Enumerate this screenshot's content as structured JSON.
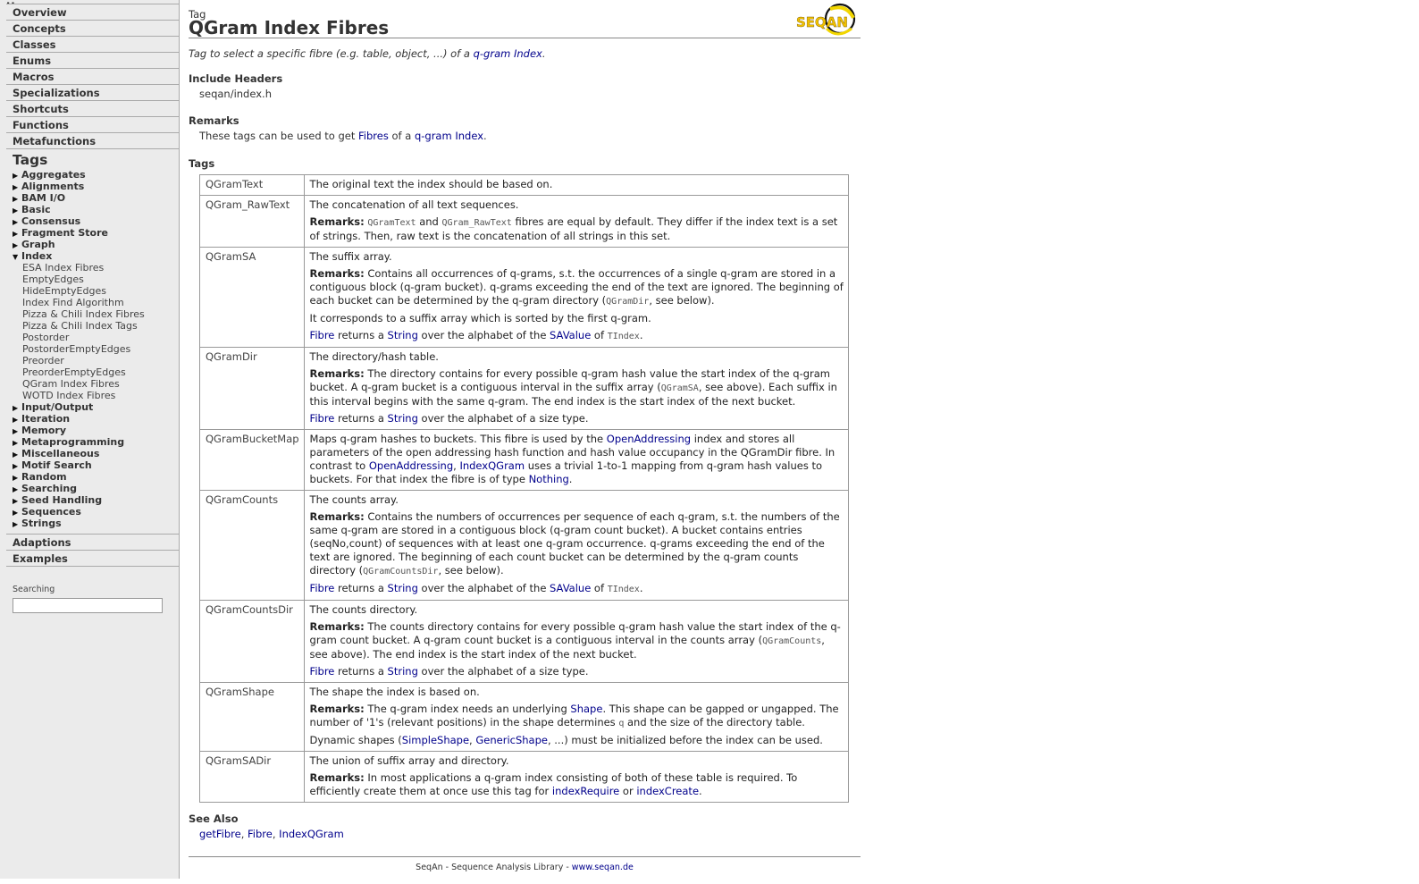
{
  "nav": {
    "top_cut": "Home",
    "cats_top": [
      "Overview",
      "Concepts",
      "Classes",
      "Enums",
      "Macros",
      "Specializations",
      "Shortcuts",
      "Functions",
      "Metafunctions"
    ],
    "tags_title": "Tags",
    "groups_a": [
      "Aggregates",
      "Alignments",
      "BAM I/O",
      "Basic",
      "Consensus",
      "Fragment Store",
      "Graph"
    ],
    "open_group": "Index",
    "index_items": [
      "ESA Index Fibres",
      "EmptyEdges",
      "HideEmptyEdges",
      "Index Find Algorithm",
      "Pizza & Chili Index Fibres",
      "Pizza & Chili Index Tags",
      "Postorder",
      "PostorderEmptyEdges",
      "Preorder",
      "PreorderEmptyEdges",
      "QGram Index Fibres",
      "WOTD Index Fibres"
    ],
    "groups_b": [
      "Input/Output",
      "Iteration",
      "Memory",
      "Metaprogramming",
      "Miscellaneous",
      "Motif Search",
      "Random",
      "Searching",
      "Seed Handling",
      "Sequences",
      "Strings"
    ],
    "cats_bottom": [
      "Adaptions",
      "Examples"
    ],
    "search_label": "Searching",
    "search_value": ""
  },
  "page": {
    "kind": "Tag",
    "title": "QGram Index Fibres",
    "logo_text": "SEQAN",
    "summary_prefix": "Tag to select a specific fibre (e.g. table, object, ...) of a ",
    "summary_link": "q-gram Index",
    "summary_suffix": ".",
    "include_heading": "Include Headers",
    "include_value": "seqan/index.h",
    "remarks_heading": "Remarks",
    "remarks_prefix": "These tags can be used to get ",
    "remarks_link1": "Fibres",
    "remarks_mid": " of a ",
    "remarks_link2": "q-gram Index",
    "remarks_suffix": ".",
    "tags_heading": "Tags",
    "see_also_heading": "See Also",
    "see_also": [
      "getFibre",
      "Fibre",
      "IndexQGram"
    ],
    "footer_text": "SeqAn - Sequence Analysis Library - ",
    "footer_link": "www.seqan.de"
  },
  "tags": [
    {
      "name": "QGramText",
      "paras": [
        [
          {
            "t": "The original text the index should be based on."
          }
        ]
      ]
    },
    {
      "name": "QGram_RawText",
      "paras": [
        [
          {
            "t": "The concatenation of all text sequences."
          }
        ],
        [
          {
            "b": "Remarks:"
          },
          {
            "t": " "
          },
          {
            "c": "QGramText"
          },
          {
            "t": " and "
          },
          {
            "c": "QGram_RawText"
          },
          {
            "t": " fibres are equal by default. They differ if the index text is a set of strings. Then, raw text is the concatenation of all strings in this set."
          }
        ]
      ]
    },
    {
      "name": "QGramSA",
      "paras": [
        [
          {
            "t": "The suffix array."
          }
        ],
        [
          {
            "b": "Remarks:"
          },
          {
            "t": " Contains all occurrences of q-grams, s.t. the occurrences of a single q-gram are stored in a contiguous block (q-gram bucket). q-grams exceeding the end of the text are ignored. The beginning of each bucket can be determined by the q-gram directory ("
          },
          {
            "c": "QGramDir"
          },
          {
            "t": ", see below)."
          }
        ],
        [
          {
            "t": "It corresponds to a suffix array which is sorted by the first q-gram."
          }
        ],
        [
          {
            "a": "Fibre"
          },
          {
            "t": " returns a "
          },
          {
            "a": "String"
          },
          {
            "t": " over the alphabet of the "
          },
          {
            "a": "SAValue"
          },
          {
            "t": " of "
          },
          {
            "c": "TIndex"
          },
          {
            "t": "."
          }
        ]
      ]
    },
    {
      "name": "QGramDir",
      "paras": [
        [
          {
            "t": "The directory/hash table."
          }
        ],
        [
          {
            "b": "Remarks:"
          },
          {
            "t": " The directory contains for every possible q-gram hash value the start index of the q-gram bucket. A q-gram bucket is a contiguous interval in the suffix array ("
          },
          {
            "c": "QGramSA"
          },
          {
            "t": ", see above). Each suffix in this interval begins with the same q-gram. The end index is the start index of the next bucket."
          }
        ],
        [
          {
            "a": "Fibre"
          },
          {
            "t": " returns a "
          },
          {
            "a": "String"
          },
          {
            "t": " over the alphabet of a size type."
          }
        ]
      ]
    },
    {
      "name": "QGramBucketMap",
      "paras": [
        [
          {
            "t": "Maps q-gram hashes to buckets. This fibre is used by the "
          },
          {
            "a": "OpenAddressing"
          },
          {
            "t": " index and stores all parameters of the open addressing hash function and hash value occupancy in the QGramDir fibre. In contrast to "
          },
          {
            "a": "OpenAddressing"
          },
          {
            "t": ", "
          },
          {
            "a": "IndexQGram"
          },
          {
            "t": " uses a trivial 1-to-1 mapping from q-gram hash values to buckets. For that index the fibre is of type "
          },
          {
            "a": "Nothing"
          },
          {
            "t": "."
          }
        ]
      ]
    },
    {
      "name": "QGramCounts",
      "paras": [
        [
          {
            "t": "The counts array."
          }
        ],
        [
          {
            "b": "Remarks:"
          },
          {
            "t": " Contains the numbers of occurrences per sequence of each q-gram, s.t. the numbers of the same q-gram are stored in a contiguous block (q-gram count bucket). A bucket contains entries (seqNo,count) of sequences with at least one q-gram occurrence. q-grams exceeding the end of the text are ignored. The beginning of each count bucket can be determined by the q-gram counts directory ("
          },
          {
            "c": "QGramCountsDir"
          },
          {
            "t": ", see below)."
          }
        ],
        [
          {
            "a": "Fibre"
          },
          {
            "t": " returns a "
          },
          {
            "a": "String"
          },
          {
            "t": " over the alphabet of the "
          },
          {
            "a": "SAValue"
          },
          {
            "t": " of "
          },
          {
            "c": "TIndex"
          },
          {
            "t": "."
          }
        ]
      ]
    },
    {
      "name": "QGramCountsDir",
      "paras": [
        [
          {
            "t": "The counts directory."
          }
        ],
        [
          {
            "b": "Remarks:"
          },
          {
            "t": " The counts directory contains for every possible q-gram hash value the start index of the q-gram count bucket. A q-gram count bucket is a contiguous interval in the counts array ("
          },
          {
            "c": "QGramCounts"
          },
          {
            "t": ", see above). The end index is the start index of the next bucket."
          }
        ],
        [
          {
            "a": "Fibre"
          },
          {
            "t": " returns a "
          },
          {
            "a": "String"
          },
          {
            "t": " over the alphabet of a size type."
          }
        ]
      ]
    },
    {
      "name": "QGramShape",
      "paras": [
        [
          {
            "t": "The shape the index is based on."
          }
        ],
        [
          {
            "b": "Remarks:"
          },
          {
            "t": " The q-gram index needs an underlying "
          },
          {
            "a": "Shape"
          },
          {
            "t": ". This shape can be gapped or ungapped. The number of '1's (relevant positions) in the shape determines "
          },
          {
            "c": "q"
          },
          {
            "t": " and the size of the directory table."
          }
        ],
        [
          {
            "t": "Dynamic shapes ("
          },
          {
            "a": "SimpleShape"
          },
          {
            "t": ", "
          },
          {
            "a": "GenericShape"
          },
          {
            "t": ", ...) must be initialized before the index can be used."
          }
        ]
      ]
    },
    {
      "name": "QGramSADir",
      "paras": [
        [
          {
            "t": "The union of suffix array and directory."
          }
        ],
        [
          {
            "b": "Remarks:"
          },
          {
            "t": " In most applications a q-gram index consisting of both of these table is required. To efficiently create them at once use this tag for "
          },
          {
            "a": "indexRequire"
          },
          {
            "t": " or "
          },
          {
            "a": "indexCreate"
          },
          {
            "t": "."
          }
        ]
      ]
    }
  ],
  "colors": {
    "link": "#00008b",
    "sidebar_bg": "#ebebeb",
    "logo_yellow": "#f2d600",
    "logo_text": "#f2c200"
  }
}
